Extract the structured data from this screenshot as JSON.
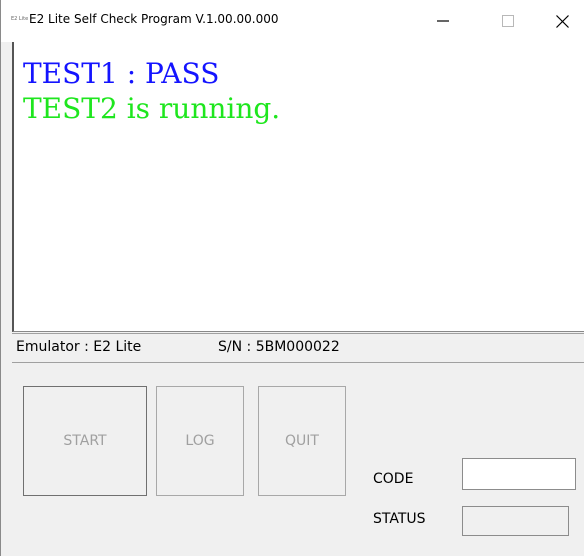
{
  "window": {
    "title": "E2 Lite Self Check Program V.1.00.00.000",
    "icon_text": "E2 Lite",
    "controls": {
      "minimize": "minimize-icon",
      "maximize": "maximize-icon",
      "close": "close-icon"
    }
  },
  "console": {
    "lines": [
      {
        "text": "TEST1 : PASS",
        "color": "#1414ff"
      },
      {
        "text": "TEST2 is running.",
        "color": "#1ee61e"
      }
    ]
  },
  "info": {
    "emulator": "Emulator : E2 Lite",
    "serial": "S/N : 5BM000022"
  },
  "buttons": {
    "start": "START",
    "log": "LOG",
    "quit": "QUIT"
  },
  "fields": {
    "code_label": "CODE",
    "code_value": "",
    "status_label": "STATUS",
    "status_value": ""
  }
}
